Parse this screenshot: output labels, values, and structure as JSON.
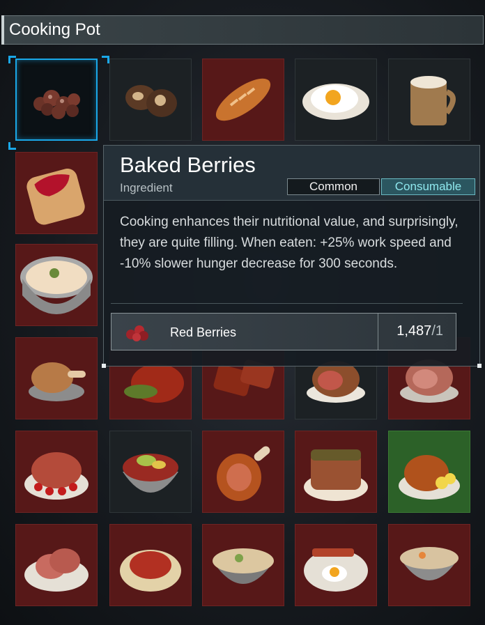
{
  "window": {
    "title": "Cooking Pot"
  },
  "tooltip": {
    "item_name": "Baked Berries",
    "item_type": "Ingredient",
    "rarity": "Common",
    "category": "Consumable",
    "description": "Cooking enhances their nutritional value, and surprisingly, they are quite filling. When eaten: +25% work speed and -10% slower hunger decrease for 300 seconds.",
    "ingredient": {
      "name": "Red Berries",
      "owned": "1,487",
      "required": "/1",
      "icon": "red-berries-icon"
    }
  },
  "grid": {
    "selected": "baked-berries",
    "colors": {
      "accent": "#1aa8e8",
      "locked_slot": "#571818",
      "available_slot": "#1c2124",
      "rare_slot": "#2c6128"
    }
  }
}
